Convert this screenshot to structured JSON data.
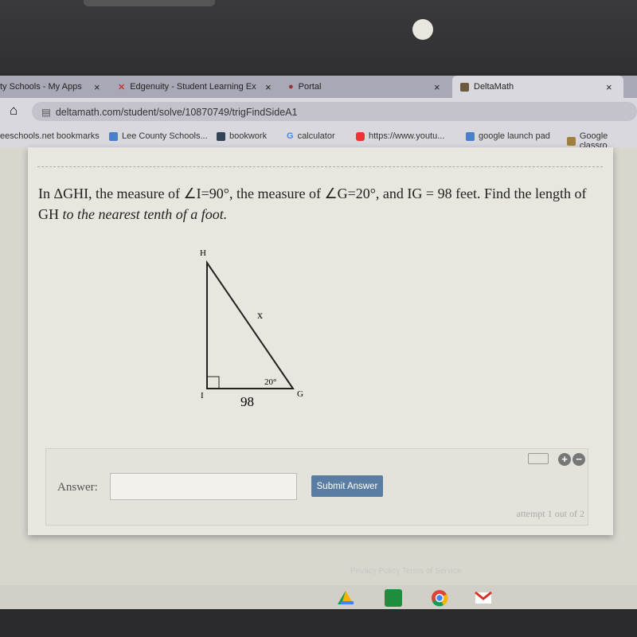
{
  "browser": {
    "tabs": [
      {
        "label": "ty Schools - My Apps",
        "active": false
      },
      {
        "label": "Edgenuity - Student Learning Ex",
        "active": false
      },
      {
        "label": "Portal",
        "active": false
      },
      {
        "label": "DeltaMath",
        "active": true
      }
    ],
    "close_glyph": "×",
    "url": "deltamath.com/student/solve/10870749/trigFindSideA1",
    "bookmarks": [
      "eeschools.net bookmarks",
      "Lee County Schools...",
      "bookwork",
      "calculator",
      "https://www.youtu...",
      "google launch pad",
      "Google classro"
    ]
  },
  "problem": {
    "text_main": "In ΔGHI, the measure of ∠I=90°, the measure of ∠G=20°, and IG = 98 feet. Find the length of GH ",
    "text_italic": "to the nearest tenth of a foot.",
    "diagram": {
      "vertex_h": "H",
      "vertex_i": "I",
      "vertex_g": "G",
      "hyp_label": "x",
      "angle_label": "20°",
      "base_label": "98"
    }
  },
  "answer": {
    "label": "Answer:",
    "value": "",
    "submit_label": "Submit Answer",
    "attempt": "attempt 1 out of 2",
    "plus": "+",
    "minus": "−"
  },
  "footer": "Privacy Policy   Terms of Service",
  "colors": {
    "submit": "#5a7ea3",
    "page": "#d8d6cd",
    "card": "#e7e6df"
  }
}
